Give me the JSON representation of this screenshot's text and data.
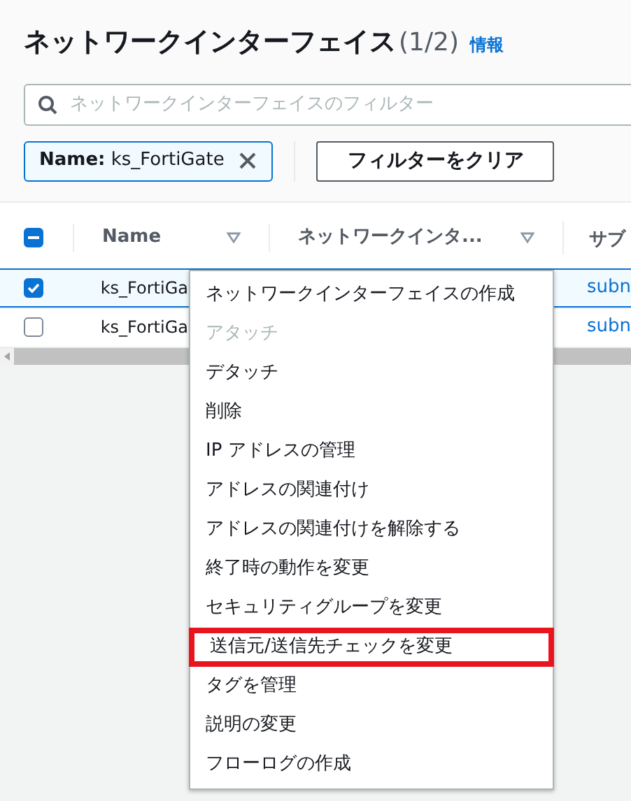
{
  "header": {
    "title": "ネットワークインターフェイス",
    "count": "(1/2)",
    "info_link": "情報"
  },
  "search": {
    "placeholder": "ネットワークインターフェイスのフィルター"
  },
  "filter_token": {
    "key": "Name:",
    "value": "ks_FortiGate"
  },
  "clear_button": "フィルターをクリア",
  "table": {
    "header_checkbox_indeterminate": true,
    "columns": [
      "Name",
      "ネットワークインタ...",
      "サブ"
    ],
    "rows": [
      {
        "selected": true,
        "cells": [
          "ks_FortiGa",
          "subn"
        ]
      },
      {
        "selected": false,
        "cells": [
          "ks_FortiGa",
          "subn"
        ]
      }
    ]
  },
  "context_menu": [
    {
      "label": "ネットワークインターフェイスの作成",
      "disabled": false,
      "highlighted": false
    },
    {
      "label": "アタッチ",
      "disabled": true,
      "highlighted": false
    },
    {
      "label": "デタッチ",
      "disabled": false,
      "highlighted": false
    },
    {
      "label": "削除",
      "disabled": false,
      "highlighted": false
    },
    {
      "label": "IP アドレスの管理",
      "disabled": false,
      "highlighted": false
    },
    {
      "label": "アドレスの関連付け",
      "disabled": false,
      "highlighted": false
    },
    {
      "label": "アドレスの関連付けを解除する",
      "disabled": false,
      "highlighted": false
    },
    {
      "label": "終了時の動作を変更",
      "disabled": false,
      "highlighted": false
    },
    {
      "label": "セキュリティグループを変更",
      "disabled": false,
      "highlighted": false
    },
    {
      "label": "送信元/送信先チェックを変更",
      "disabled": false,
      "highlighted": true
    },
    {
      "label": "タグを管理",
      "disabled": false,
      "highlighted": false
    },
    {
      "label": "説明の変更",
      "disabled": false,
      "highlighted": false
    },
    {
      "label": "フローログの作成",
      "disabled": false,
      "highlighted": false
    }
  ]
}
